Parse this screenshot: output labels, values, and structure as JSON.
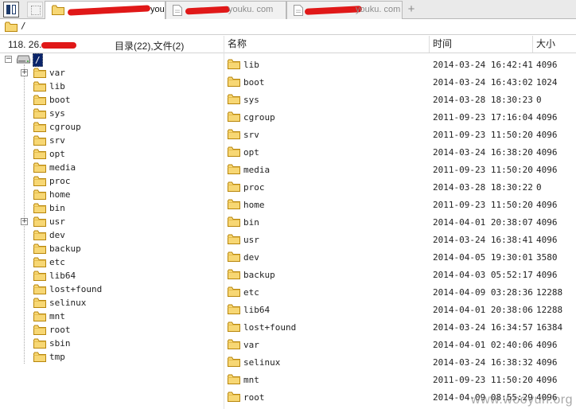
{
  "tabs": [
    {
      "prefix": "",
      "suffix": "youku. com",
      "active": true
    },
    {
      "prefix": "",
      "suffix": " youku. com",
      "active": false
    },
    {
      "prefix": "",
      "suffix": "youku. com",
      "active": false
    }
  ],
  "new_tab_label": "+",
  "path": "/",
  "left_panel": {
    "host_ip": "118. 26.",
    "summary": "目录(22),文件(2)"
  },
  "tree": {
    "root_label": "/",
    "items": [
      {
        "label": "var",
        "expandable": true
      },
      {
        "label": "lib",
        "expandable": false
      },
      {
        "label": "boot",
        "expandable": false
      },
      {
        "label": "sys",
        "expandable": false
      },
      {
        "label": "cgroup",
        "expandable": false
      },
      {
        "label": "srv",
        "expandable": false
      },
      {
        "label": "opt",
        "expandable": false
      },
      {
        "label": "media",
        "expandable": false
      },
      {
        "label": "proc",
        "expandable": false
      },
      {
        "label": "home",
        "expandable": false
      },
      {
        "label": "bin",
        "expandable": false
      },
      {
        "label": "usr",
        "expandable": true
      },
      {
        "label": "dev",
        "expandable": false
      },
      {
        "label": "backup",
        "expandable": false
      },
      {
        "label": "etc",
        "expandable": false
      },
      {
        "label": "lib64",
        "expandable": false
      },
      {
        "label": "lost+found",
        "expandable": false
      },
      {
        "label": "selinux",
        "expandable": false
      },
      {
        "label": "mnt",
        "expandable": false
      },
      {
        "label": "root",
        "expandable": false
      },
      {
        "label": "sbin",
        "expandable": false
      },
      {
        "label": "tmp",
        "expandable": false
      }
    ]
  },
  "list": {
    "columns": {
      "name": "名称",
      "time": "时间",
      "size": "大小"
    },
    "rows": [
      {
        "name": "lib",
        "time": "2014-03-24 16:42:41",
        "size": "4096"
      },
      {
        "name": "boot",
        "time": "2014-03-24 16:43:02",
        "size": "1024"
      },
      {
        "name": "sys",
        "time": "2014-03-28 18:30:23",
        "size": "0"
      },
      {
        "name": "cgroup",
        "time": "2011-09-23 17:16:04",
        "size": "4096"
      },
      {
        "name": "srv",
        "time": "2011-09-23 11:50:20",
        "size": "4096"
      },
      {
        "name": "opt",
        "time": "2014-03-24 16:38:20",
        "size": "4096"
      },
      {
        "name": "media",
        "time": "2011-09-23 11:50:20",
        "size": "4096"
      },
      {
        "name": "proc",
        "time": "2014-03-28 18:30:22",
        "size": "0"
      },
      {
        "name": "home",
        "time": "2011-09-23 11:50:20",
        "size": "4096"
      },
      {
        "name": "bin",
        "time": "2014-04-01 20:38:07",
        "size": "4096"
      },
      {
        "name": "usr",
        "time": "2014-03-24 16:38:41",
        "size": "4096"
      },
      {
        "name": "dev",
        "time": "2014-04-05 19:30:01",
        "size": "3580"
      },
      {
        "name": "backup",
        "time": "2014-04-03 05:52:17",
        "size": "4096"
      },
      {
        "name": "etc",
        "time": "2014-04-09 03:28:36",
        "size": "12288"
      },
      {
        "name": "lib64",
        "time": "2014-04-01 20:38:06",
        "size": "12288"
      },
      {
        "name": "lost+found",
        "time": "2014-03-24 16:34:57",
        "size": "16384"
      },
      {
        "name": "var",
        "time": "2014-04-01 02:40:06",
        "size": "4096"
      },
      {
        "name": "selinux",
        "time": "2014-03-24 16:38:32",
        "size": "4096"
      },
      {
        "name": "mnt",
        "time": "2011-09-23 11:50:20",
        "size": "4096"
      },
      {
        "name": "root",
        "time": "2014-04-09 08:55:29",
        "size": "4096"
      }
    ]
  },
  "watermark": "www.wooyun.org",
  "icons": {
    "panel_toggle": "panel-toggle-icon",
    "view_toggle": "view-toggle-icon",
    "tab_page": "page-icon",
    "folder": "folder-icon",
    "drive": "drive-icon",
    "expand": "plus-box-icon",
    "collapse": "minus-box-icon"
  },
  "colors": {
    "folder_fill": "#f7d774",
    "folder_stroke": "#b8860b",
    "selection": "#0a246a",
    "redaction": "#e01818"
  }
}
